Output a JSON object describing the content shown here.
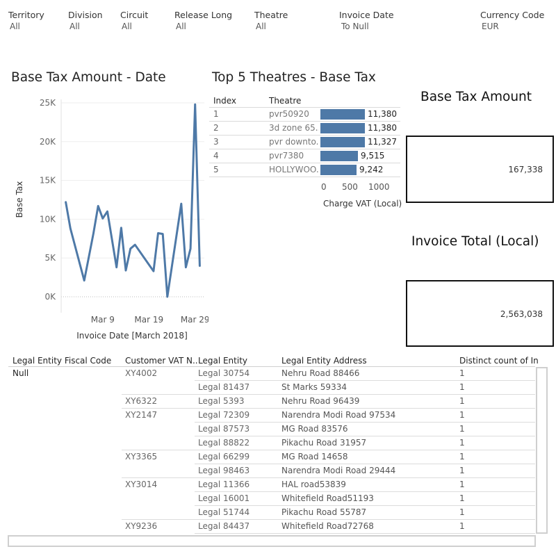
{
  "filters": [
    {
      "label": "Territory",
      "value": "All"
    },
    {
      "label": "Division",
      "value": "All"
    },
    {
      "label": "Circuit",
      "value": "All"
    },
    {
      "label": "Release Long",
      "value": "All"
    },
    {
      "label": "Theatre",
      "value": "All"
    },
    {
      "label": "Invoice Date",
      "value": "To Null"
    },
    {
      "label": "Currency Code",
      "value": "EUR"
    }
  ],
  "line_chart": {
    "title": "Base Tax Amount - Date"
  },
  "top5": {
    "title": "Top 5 Theatres - Base Tax",
    "col_index": "Index",
    "col_theatre": "Theatre",
    "axis_title": "Charge VAT (Local)",
    "ticks": [
      "0",
      "500",
      "1000"
    ],
    "rows": [
      {
        "index": "1",
        "theatre": "pvr50920",
        "value": 11380,
        "label": "11,380"
      },
      {
        "index": "2",
        "theatre": "3d zone 65..",
        "value": 11380,
        "label": "11,380"
      },
      {
        "index": "3",
        "theatre": "pvr downto..",
        "value": 11327,
        "label": "11,327"
      },
      {
        "index": "4",
        "theatre": "pvr7380",
        "value": 9515,
        "label": "9,515"
      },
      {
        "index": "5",
        "theatre": "HOLLYWOO..",
        "value": 9242,
        "label": "9,242"
      }
    ]
  },
  "kpis": {
    "base_tax_title": "Base Tax Amount",
    "base_tax_value": "167,338",
    "invoice_total_title": "Invoice Total (Local)",
    "invoice_total_value": "2,563,038"
  },
  "detail_table": {
    "headers": [
      "Legal Entity Fiscal Code",
      "Customer VAT N..",
      "Legal Entity",
      "Legal Entity Address",
      "Distinct count of In"
    ],
    "fiscal_code": "Null",
    "rows": [
      {
        "vat": "XY4002",
        "entity": "Legal 30754",
        "address": "Nehru Road 88466",
        "count": "1"
      },
      {
        "vat": "",
        "entity": "Legal 81437",
        "address": "St Marks 59334",
        "count": "1"
      },
      {
        "vat": "XY6322",
        "entity": "Legal 5393",
        "address": "Nehru Road 96439",
        "count": "1"
      },
      {
        "vat": "XY2147",
        "entity": "Legal 72309",
        "address": "Narendra Modi Road 97534",
        "count": "1"
      },
      {
        "vat": "",
        "entity": "Legal 87573",
        "address": "MG Road 83576",
        "count": "1"
      },
      {
        "vat": "",
        "entity": "Legal 88822",
        "address": "Pikachu Road 31957",
        "count": "1"
      },
      {
        "vat": "XY3365",
        "entity": "Legal 66299",
        "address": "MG Road 14658",
        "count": "1"
      },
      {
        "vat": "",
        "entity": "Legal 98463",
        "address": "Narendra Modi Road 29444",
        "count": "1"
      },
      {
        "vat": "XY3014",
        "entity": "Legal 11366",
        "address": " HAL road53839",
        "count": "1"
      },
      {
        "vat": "",
        "entity": "Legal 16001",
        "address": "Whitefield Road51193",
        "count": "1"
      },
      {
        "vat": "",
        "entity": "Legal 51744",
        "address": "Pikachu Road 55787",
        "count": "1"
      },
      {
        "vat": "XY9236",
        "entity": "Legal 84437",
        "address": "Whitefield Road72768",
        "count": "1"
      }
    ]
  },
  "colors": {
    "accent": "#4e79a7",
    "grid": "#d9d9d9",
    "kpi_border": "#111111"
  },
  "chart_data": {
    "type": "line",
    "title": "",
    "xlabel": "Invoice Date [March 2018]",
    "ylabel": "Base Tax",
    "x_unit": "day of March 2018",
    "x_tick_labels": [
      "Mar 9",
      "Mar 19",
      "Mar 29"
    ],
    "x_ticks": [
      9,
      19,
      29
    ],
    "xlim": [
      0,
      31
    ],
    "y_tick_labels": [
      "0K",
      "5K",
      "10K",
      "15K",
      "20K",
      "25K"
    ],
    "y_ticks": [
      0,
      5000,
      10000,
      15000,
      20000,
      25000
    ],
    "ylim": [
      0,
      25500
    ],
    "grid": true,
    "series": [
      {
        "x": [
          1,
          2,
          5,
          7,
          8,
          9,
          10,
          12,
          13,
          14,
          15,
          16,
          20,
          21,
          22,
          23,
          26,
          27,
          28,
          29,
          30
        ],
        "y": [
          12200,
          8800,
          2100,
          8200,
          11700,
          10100,
          11000,
          3800,
          8900,
          3400,
          6200,
          6700,
          3300,
          8200,
          8100,
          0,
          12000,
          3800,
          6200,
          24800,
          4000
        ]
      }
    ]
  }
}
